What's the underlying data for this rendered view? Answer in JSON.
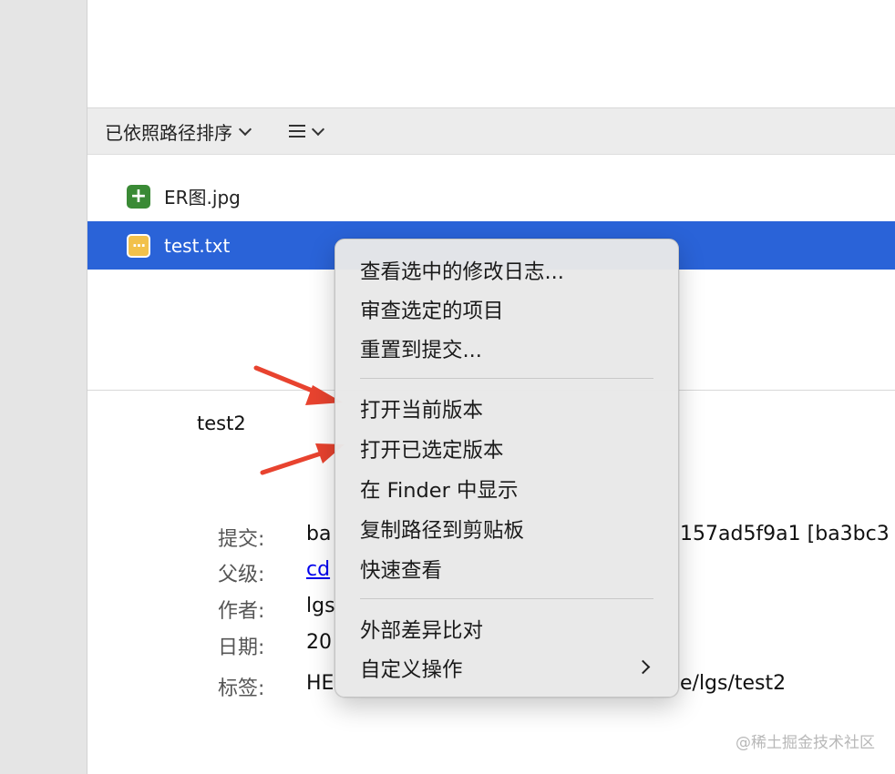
{
  "toolbar": {
    "sort_label": "已依照路径排序"
  },
  "files": [
    {
      "name": "ER图.jpg",
      "status": "added",
      "icon": "plus-icon"
    },
    {
      "name": "test.txt",
      "status": "modified",
      "icon": "ellipsis-icon"
    }
  ],
  "commit": {
    "message": "test2",
    "labels": {
      "commit": "提交:",
      "parent": "父级:",
      "author": "作者:",
      "date": "日期:",
      "tags": "标签:"
    },
    "values": {
      "commit_prefix": "ba",
      "commit_suffix": "157ad5f9a1 [ba3bc3",
      "parent": "cd",
      "author": "lgs",
      "date": "20",
      "tags_prefix": "HE",
      "tags_suffix": "e/lgs/test2"
    }
  },
  "context_menu": {
    "items": [
      "查看选中的修改日志...",
      "审查选定的项目",
      "重置到提交...",
      "打开当前版本",
      "打开已选定版本",
      "在 Finder 中显示",
      "复制路径到剪贴板",
      "快速查看",
      "外部差异比对",
      "自定义操作"
    ]
  },
  "watermark": "@稀土掘金技术社区",
  "colors": {
    "selection": "#2a63d8",
    "added_icon": "#3a8a35",
    "modified_icon": "#f2c14b",
    "arrow": "#e8432f"
  }
}
